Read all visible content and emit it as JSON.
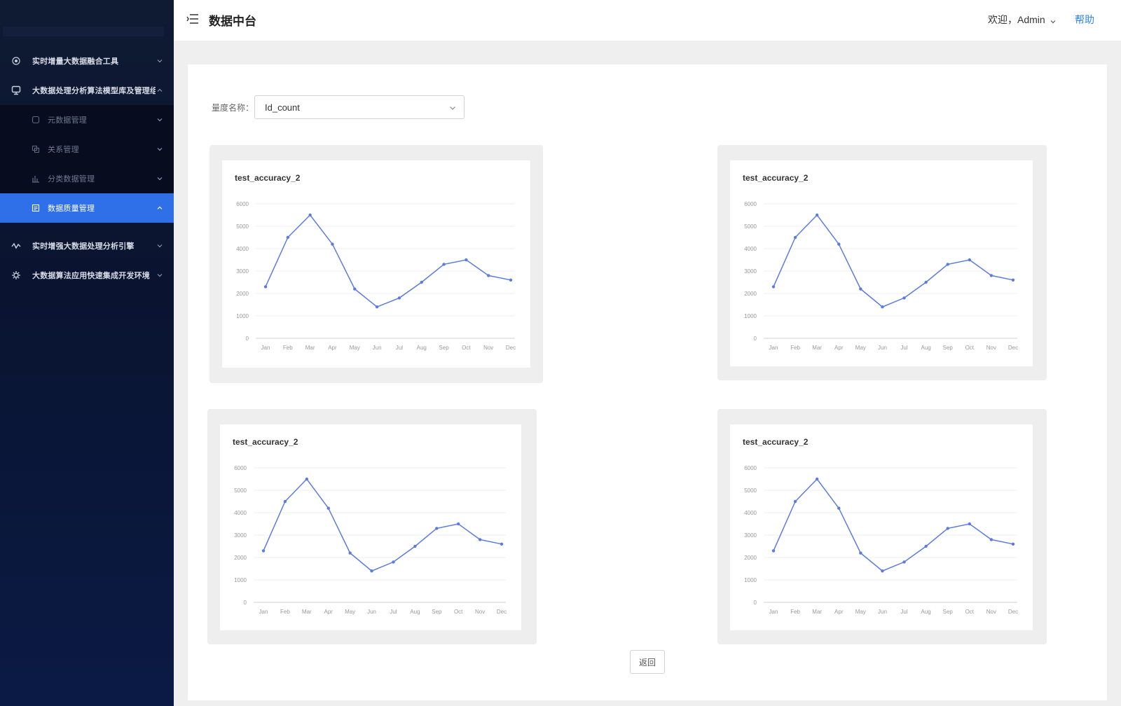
{
  "app": {
    "title": "数据中台"
  },
  "header": {
    "welcome": "欢迎，Admin",
    "help": "帮助"
  },
  "sidebar": {
    "items": [
      {
        "label": "实时增量大数据融合工具",
        "icon": "gear-dot-icon"
      },
      {
        "label": "大数据处理分析算法模型库及管理组件",
        "icon": "model-icon"
      },
      {
        "label": "实时增强大数据处理分析引擎",
        "icon": "pulse-icon"
      },
      {
        "label": "大数据算法应用快速集成开发环境",
        "icon": "settings-icon"
      }
    ],
    "sub_items": [
      {
        "label": "元数据管理",
        "icon": "database-icon"
      },
      {
        "label": "关系管理",
        "icon": "copy-icon"
      },
      {
        "label": "分类数据管理",
        "icon": "bar-chart-icon"
      },
      {
        "label": "数据质量管理",
        "icon": "doc-icon"
      }
    ]
  },
  "filter": {
    "label": "量度名称：",
    "value": "Id_count"
  },
  "charts": [
    {
      "title": "test_accuracy_2"
    },
    {
      "title": "test_accuracy_2"
    },
    {
      "title": "test_accuracy_2"
    },
    {
      "title": "test_accuracy_2"
    }
  ],
  "back_button": "返回",
  "colors": {
    "accent": "#2f6fe8",
    "line": "#5b7be0",
    "sidebar": "#0c1733",
    "link": "#2f86f6"
  },
  "chart_data": {
    "type": "line",
    "title": "test_accuracy_2",
    "x": [
      "Jan",
      "Feb",
      "Mar",
      "Apr",
      "May",
      "Jun",
      "Jul",
      "Aug",
      "Sep",
      "Oct",
      "Nov",
      "Dec"
    ],
    "yticks": [
      "0",
      "1000",
      "2000",
      "3000",
      "4000",
      "5000",
      "6000"
    ],
    "values": [
      2300,
      4500,
      5500,
      4200,
      2200,
      1400,
      1800,
      2500,
      3300,
      3500,
      2800,
      2600
    ],
    "ylim": [
      0,
      6000
    ],
    "grid": true
  }
}
